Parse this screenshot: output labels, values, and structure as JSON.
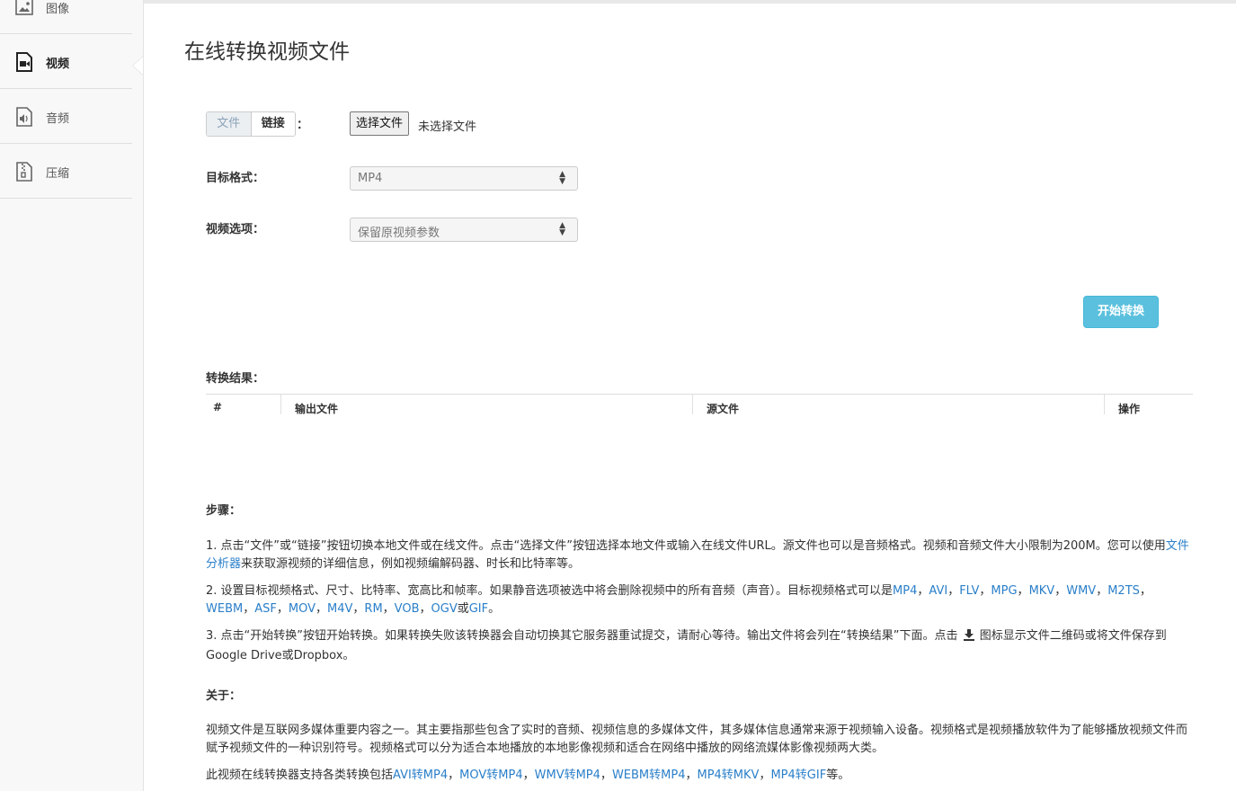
{
  "sidebar": {
    "items": [
      {
        "label": "图像",
        "icon": "image-icon"
      },
      {
        "label": "视频",
        "icon": "video-icon"
      },
      {
        "label": "音频",
        "icon": "audio-icon"
      },
      {
        "label": "压缩",
        "icon": "zip-icon"
      }
    ],
    "active": "视频"
  },
  "page": {
    "title": "在线转换视频文件"
  },
  "form": {
    "source_tabs": [
      "文件",
      "链接"
    ],
    "source_colon": "：",
    "file_button": "选择文件",
    "file_status": "未选择文件",
    "format_label": "目标格式：",
    "format_value": "MP4",
    "option_label": "视频选项：",
    "option_value": "保留原视频参数",
    "start_button": "开始转换"
  },
  "results": {
    "title": "转换结果：",
    "columns": [
      "#",
      "输出文件",
      "源文件",
      "操作"
    ]
  },
  "steps": {
    "title": "步骤：",
    "s1_a": "1. 点击“文件”或“链接”按钮切换本地文件或在线文件。点击“选择文件”按钮选择本地文件或输入在线文件URL。源文件也可以是音频格式。视频和音频文件大小限制为200M。您可以使用",
    "s1_link": "文件分析器",
    "s1_b": "来获取源视频的详细信息，例如视频编解码器、时长和比特率等。",
    "s2_a": "2. 设置目标视频格式、尺寸、比特率、宽高比和帧率。如果静音选项被选中将会删除视频中的所有音频（声音）。目标视频格式可以是",
    "s2_formats": [
      "MP4",
      "AVI",
      "FLV",
      "MPG",
      "MKV",
      "WMV",
      "M2TS",
      "WEBM",
      "ASF",
      "MOV",
      "M4V",
      "RM",
      "VOB",
      "OGV"
    ],
    "s2_sep": "，",
    "s2_or": "或",
    "s2_last": "GIF",
    "s2_end": "。",
    "s3_a": "3. 点击“开始转换”按钮开始转换。如果转换失败该转换器会自动切换其它服务器重试提交，请耐心等待。输出文件将会列在“转换结果”下面。点击",
    "s3_b": "图标显示文件二维码或将文件保存到Google Drive或Dropbox。"
  },
  "about": {
    "title": "关于：",
    "p1": "视频文件是互联网多媒体重要内容之一。其主要指那些包含了实时的音频、视频信息的多媒体文件，其多媒体信息通常来源于视频输入设备。视频格式是视频播放软件为了能够播放视频文件而赋予视频文件的一种识别符号。视频格式可以分为适合本地播放的本地影像视频和适合在网络中播放的网络流媒体影像视频两大类。",
    "p2_a": "此视频在线转换器支持各类转换包括",
    "p2_links": [
      "AVI转MP4",
      "MOV转MP4",
      "WMV转MP4",
      "WEBM转MP4",
      "MP4转MKV",
      "MP4转GIF"
    ],
    "p2_end": "等。"
  },
  "colors": {
    "accent": "#5bc0de",
    "link": "#2a7fc9"
  }
}
